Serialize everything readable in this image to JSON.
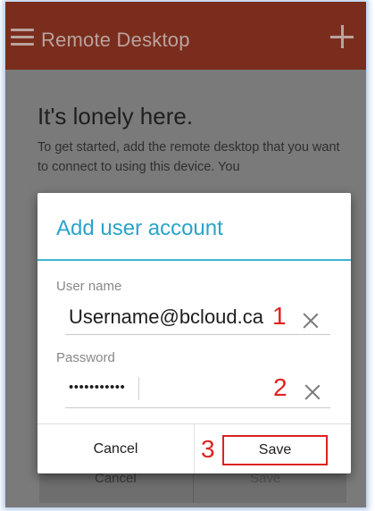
{
  "appbar": {
    "title": "Remote Desktop",
    "menu_icon": "hamburger-menu-icon",
    "add_icon": "plus-icon"
  },
  "empty_state": {
    "heading": "It's lonely here.",
    "body": "To get started, add the remote desktop that you want to connect to using this device. You"
  },
  "background_dialog": {
    "cancel_label": "Cancel",
    "save_label": "Save"
  },
  "dialog": {
    "title": "Add user account",
    "username": {
      "label": "User name",
      "value": "Username@bcloud.ca",
      "marker": "1"
    },
    "password": {
      "label": "Password",
      "value": "•••••••••••",
      "marker": "2"
    },
    "actions": {
      "cancel_label": "Cancel",
      "save_label": "Save",
      "marker": "3"
    }
  },
  "colors": {
    "accent": "#2aa3cb",
    "appbar": "#7a2d1d",
    "annotation": "#e0221f"
  }
}
